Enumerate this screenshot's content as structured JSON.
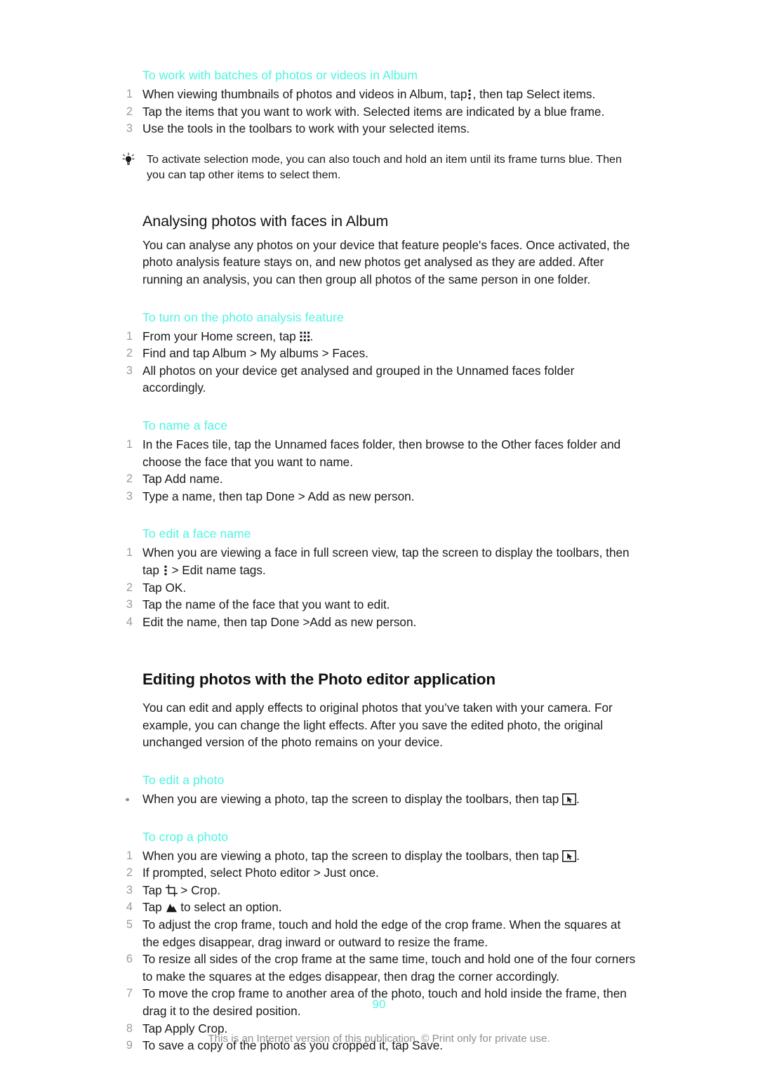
{
  "document": {
    "page_number": "90",
    "footer_text": "This is an Internet version of this publication. © Print only for private use.",
    "accent_color": "#4ef5e0",
    "number_color": "#9b9b9b",
    "text_color": "#1a1a1a"
  },
  "section_batches": {
    "heading": "To work with batches of photos or videos in Album",
    "steps": [
      {
        "num": "1",
        "text_before": "When viewing thumbnails of photos and videos in Album, tap",
        "icon": "overflow-menu-icon",
        "text_after": ", then tap Select items."
      },
      {
        "num": "2",
        "text": "Tap the items that you want to work with. Selected items are indicated by a blue frame."
      },
      {
        "num": "3",
        "text": "Use the tools in the toolbars to work with your selected items."
      }
    ],
    "tip": "To activate selection mode, you can also touch and hold an item until its frame turns blue. Then you can tap other items to select them.",
    "tip_icon": "lightbulb-tip-icon"
  },
  "section_analysing": {
    "heading": "Analysing photos with faces in Album",
    "intro": "You can analyse any photos on your device that feature people's faces. Once activated, the photo analysis feature stays on, and new photos get analysed as they are added. After running an analysis, you can then group all photos of the same person in one folder.",
    "sub_turn_on": {
      "heading": "To turn on the photo analysis feature",
      "steps": [
        {
          "num": "1",
          "text_before": "From your Home screen, tap",
          "icon": "app-grid-icon",
          "text_after": "."
        },
        {
          "num": "2",
          "text": "Find and tap Album > My albums > Faces."
        },
        {
          "num": "3",
          "text": "All photos on your device get analysed and grouped in the Unnamed faces folder accordingly."
        }
      ]
    },
    "sub_name_face": {
      "heading": "To name a face",
      "steps": [
        {
          "num": "1",
          "text": "In the Faces tile, tap the Unnamed faces folder, then browse to the Other faces folder and choose the face that you want to name."
        },
        {
          "num": "2",
          "text": "Tap Add name."
        },
        {
          "num": "3",
          "text": "Type a name, then tap Done > Add as new person."
        }
      ]
    },
    "sub_edit_face_name": {
      "heading": "To edit a face name",
      "steps": [
        {
          "num": "1",
          "text_before": "When you are viewing a face in full screen view, tap the screen to display the toolbars, then tap",
          "icon": "overflow-menu-icon",
          "text_after": "> Edit name tags."
        },
        {
          "num": "2",
          "text": "Tap OK."
        },
        {
          "num": "3",
          "text": "Tap the name of the face that you want to edit."
        },
        {
          "num": "4",
          "text": "Edit the name, then tap Done >Add as new person."
        }
      ]
    }
  },
  "section_editing": {
    "heading": "Editing photos with the Photo editor application",
    "intro": "You can edit and apply effects to original photos that you’ve taken with your camera. For example, you can change the light effects. After you save the edited photo, the original unchanged version of the photo remains on your device.",
    "sub_edit_photo": {
      "heading": "To edit a photo",
      "steps": [
        {
          "bullet": "•",
          "text_before": "When you are viewing a photo, tap the screen to display the toolbars, then tap",
          "icon": "photo-editor-icon",
          "text_after": "."
        }
      ]
    },
    "sub_crop_photo": {
      "heading": "To crop a photo",
      "steps": [
        {
          "num": "1",
          "text_before": "When you are viewing a photo, tap the screen to display the toolbars, then tap",
          "icon": "photo-editor-icon",
          "text_after": "."
        },
        {
          "num": "2",
          "text": "If prompted, select Photo editor > Just once."
        },
        {
          "num": "3",
          "text_before": "Tap",
          "icon": "crop-icon",
          "text_after": "> Crop."
        },
        {
          "num": "4",
          "text_before": "Tap",
          "icon": "mountain-icon",
          "text_after": "to select an option."
        },
        {
          "num": "5",
          "text": "To adjust the crop frame, touch and hold the edge of the crop frame. When the squares at the edges disappear, drag inward or outward to resize the frame."
        },
        {
          "num": "6",
          "text": "To resize all sides of the crop frame at the same time, touch and hold one of the four corners to make the squares at the edges disappear, then drag the corner accordingly."
        },
        {
          "num": "7",
          "text": "To move the crop frame to another area of the photo, touch and hold inside the frame, then drag it to the desired position."
        },
        {
          "num": "8",
          "text": "Tap Apply Crop."
        },
        {
          "num": "9",
          "text": "To save a copy of the photo as you cropped it, tap Save."
        }
      ]
    }
  }
}
